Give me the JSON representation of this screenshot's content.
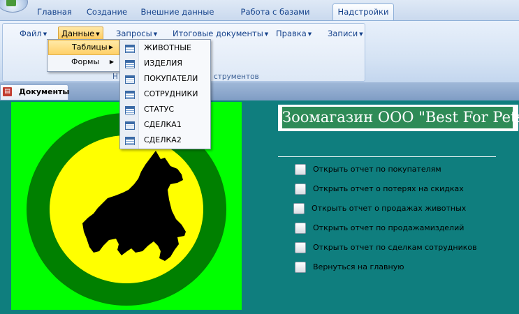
{
  "ribbon": {
    "tabs": [
      {
        "label": "Главная"
      },
      {
        "label": "Создание"
      },
      {
        "label": "Внешние данные"
      },
      {
        "label": "Работа с базами данных"
      },
      {
        "label": "Надстройки"
      }
    ],
    "menus": [
      {
        "label": "Файл"
      },
      {
        "label": "Данные"
      },
      {
        "label": "Запросы"
      },
      {
        "label": "Итоговые документы"
      },
      {
        "label": "Правка"
      },
      {
        "label": "Записи"
      }
    ],
    "group_label": "Н",
    "group_label_tail": "струментов"
  },
  "submenu": {
    "items": [
      {
        "label": "Таблицы"
      },
      {
        "label": "Формы"
      }
    ]
  },
  "table_menu": {
    "items": [
      {
        "label": "ЖИВОТНЫЕ"
      },
      {
        "label": "ИЗДЕЛИЯ"
      },
      {
        "label": "ПОКУПАТЕЛИ"
      },
      {
        "label": "СОТРУДНИКИ"
      },
      {
        "label": "СТАТУС"
      },
      {
        "label": "СДЕЛКА1"
      },
      {
        "label": "СДЕЛКА2"
      }
    ]
  },
  "document_tab": {
    "label": "Документы"
  },
  "form": {
    "title": "Зоомагазин ООО \"Best For Pets\"",
    "reports": [
      {
        "label": "Открыть отчет по покупателям"
      },
      {
        "label": "Открыть отчет о потерях на скидках"
      },
      {
        "label": "Открыть отчет о продажах животных"
      },
      {
        "label": "Открыть отчет по продажамизделий"
      },
      {
        "label": "Открыть отчет по сделкам сотрудников"
      },
      {
        "label": "Вернуться на главную"
      }
    ]
  },
  "colors": {
    "form_background": "#0f7e7e",
    "logo_background": "#00ff00",
    "logo_ring": "#008000",
    "logo_center": "#ffff00",
    "title_background": "#2e8b57"
  }
}
